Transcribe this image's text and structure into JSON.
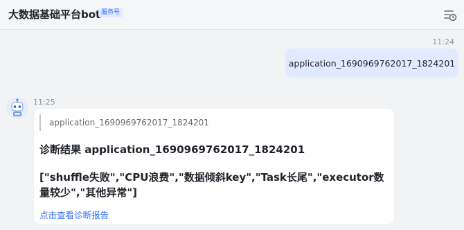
{
  "header": {
    "title": "大数据基础平台bot",
    "badge": "服务号"
  },
  "messages": {
    "outgoing": {
      "time": "11:24",
      "text": "application_1690969762017_1824201"
    },
    "incoming": {
      "time": "11:25",
      "quote": "application_1690969762017_1824201",
      "result_title": "诊断结果 application_1690969762017_1824201",
      "result_body": "[\"shuffle失败\",\"CPU浪费\",\"数据倾斜key\",\"Task长尾\",\"executor数量较少\",\"其他异常\"]",
      "link": "点击查看诊断报告"
    }
  },
  "colors": {
    "accent": "#3370ff",
    "outgoing_bubble": "#e1eaff",
    "background": "#f2f3f5"
  },
  "icons": {
    "history": "history-clock-icon",
    "avatar": "bot-avatar"
  }
}
